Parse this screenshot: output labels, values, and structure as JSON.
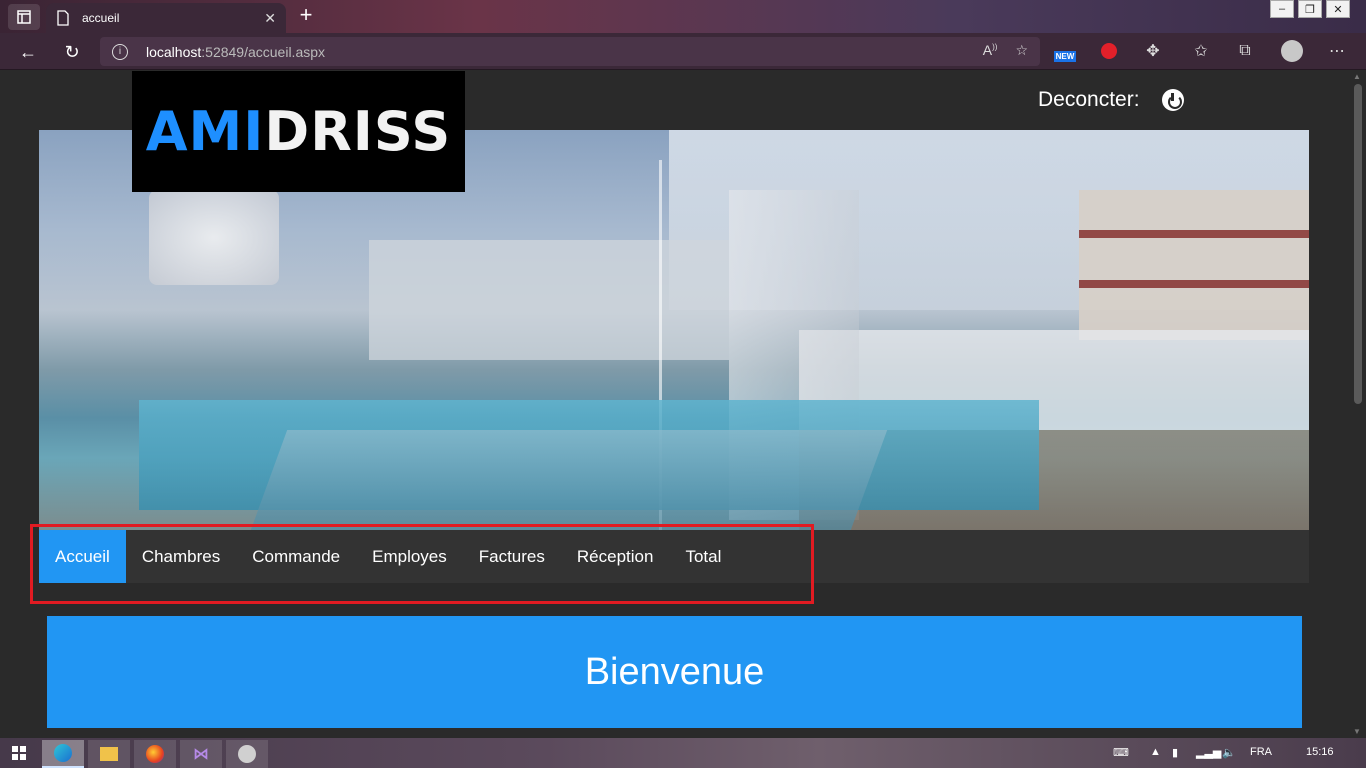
{
  "browser": {
    "tab_title": "accueil",
    "tab_close": "✕",
    "new_tab": "+",
    "url_host": "localhost",
    "url_rest": ":52849/accueil.aspx",
    "ext_badge": "NEW"
  },
  "page": {
    "logo_ami": "AMI",
    "logo_driss": "DRISS",
    "logout_label": "Deconcter:",
    "nav": [
      {
        "label": "Accueil",
        "active": true
      },
      {
        "label": "Chambres",
        "active": false
      },
      {
        "label": "Commande",
        "active": false
      },
      {
        "label": "Employes",
        "active": false
      },
      {
        "label": "Factures",
        "active": false
      },
      {
        "label": "Réception",
        "active": false
      },
      {
        "label": "Total",
        "active": false
      }
    ],
    "welcome_title": "Bienvenue",
    "accent_color": "#2196f3",
    "highlight_color": "#e11b22"
  },
  "taskbar": {
    "language": "FRA",
    "time": "15:16"
  }
}
